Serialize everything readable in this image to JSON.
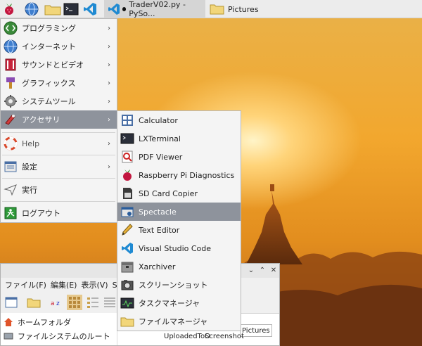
{
  "panel": {
    "tasks": [
      {
        "label": "TraderV02.py - PySo...",
        "modified": true
      },
      {
        "label": "Pictures"
      }
    ]
  },
  "menu": {
    "items": [
      {
        "label": "プログラミング",
        "icon": "programming-icon",
        "submenu": true
      },
      {
        "label": "インターネット",
        "icon": "globe-icon",
        "submenu": true
      },
      {
        "label": "サウンドとビデオ",
        "icon": "sound-video-icon",
        "submenu": true
      },
      {
        "label": "グラフィックス",
        "icon": "graphics-icon",
        "submenu": true
      },
      {
        "label": "システムツール",
        "icon": "gear-icon",
        "submenu": true
      },
      {
        "label": "アクセサリ",
        "icon": "accessories-icon",
        "submenu": true,
        "selected": true
      },
      {
        "label": "Help",
        "icon": "help-icon",
        "submenu": true
      },
      {
        "label": "設定",
        "icon": "settings-icon",
        "submenu": true
      },
      {
        "label": "実行",
        "icon": "run-icon",
        "submenu": false
      },
      {
        "label": "ログアウト",
        "icon": "logout-icon",
        "submenu": false
      }
    ]
  },
  "submenu": {
    "items": [
      {
        "label": "Calculator",
        "icon": "calculator-icon"
      },
      {
        "label": "LXTerminal",
        "icon": "terminal-icon"
      },
      {
        "label": "PDF Viewer",
        "icon": "pdf-viewer-icon"
      },
      {
        "label": "Raspberry Pi Diagnostics",
        "icon": "raspberry-icon"
      },
      {
        "label": "SD Card Copier",
        "icon": "sd-card-icon"
      },
      {
        "label": "Spectacle",
        "icon": "spectacle-icon",
        "selected": true
      },
      {
        "label": "Text Editor",
        "icon": "text-editor-icon"
      },
      {
        "label": "Visual Studio Code",
        "icon": "vscode-icon"
      },
      {
        "label": "Xarchiver",
        "icon": "archive-icon"
      },
      {
        "label": "スクリーンショット",
        "icon": "screenshot-icon"
      },
      {
        "label": "タスクマネージャ",
        "icon": "task-manager-icon"
      },
      {
        "label": "ファイルマネージャ",
        "icon": "folder-icon"
      }
    ]
  },
  "file_manager": {
    "menubar": [
      "ファイル(F)",
      "編集(E)",
      "表示(V)",
      "S"
    ],
    "path": "Pictures",
    "sidebar": [
      "ホームフォルダ",
      "ファイルシステムのルート"
    ],
    "files": [
      "UploadedToO",
      "Screenshot"
    ]
  },
  "colors": {
    "selected": "#8e939c",
    "menu_bg": "#f4f4f4",
    "panel_bg": "#ececec"
  }
}
